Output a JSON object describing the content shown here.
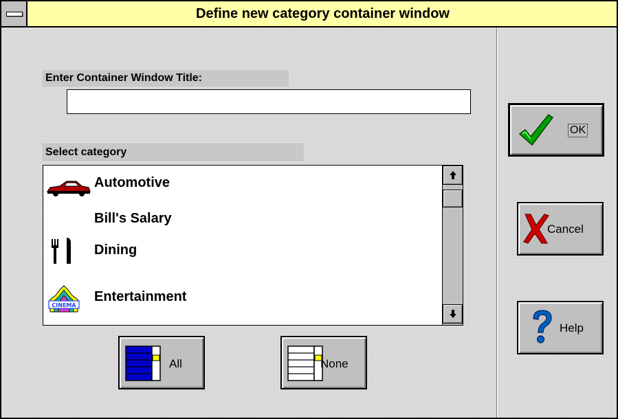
{
  "window": {
    "title": "Define new category container window"
  },
  "form": {
    "title_label": "Enter Container Window Title:",
    "title_value": "",
    "category_label": "Select category"
  },
  "categories": [
    {
      "label": "Automotive",
      "icon": "car-icon"
    },
    {
      "label": "Bill's Salary",
      "icon": ""
    },
    {
      "label": "Dining",
      "icon": "fork-knife-icon"
    },
    {
      "label": "Entertainment",
      "icon": "cinema-icon"
    }
  ],
  "buttons": {
    "ok": "OK",
    "cancel": "Cancel",
    "help": "Help",
    "all": "All",
    "none": "None"
  },
  "colors": {
    "titlebar": "#ffffa8",
    "dialog": "#c8c8c8",
    "ok_check": "#00a000",
    "cancel_x": "#d00000",
    "help_q": "#0060c0",
    "list_fill_all": "#0000c8"
  }
}
